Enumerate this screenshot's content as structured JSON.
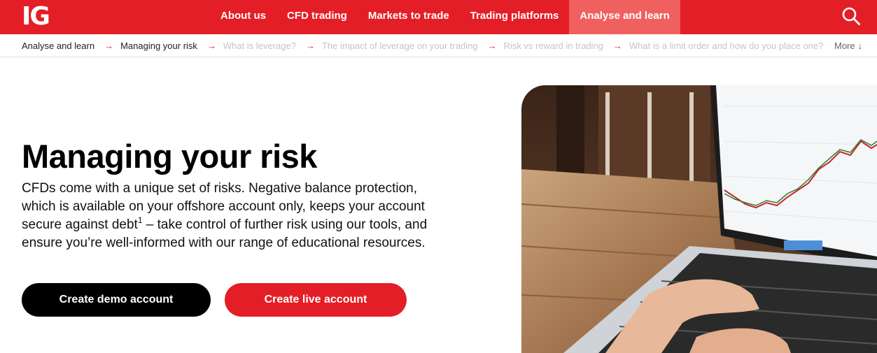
{
  "brand": {
    "logo_text": "IG",
    "accent": "#e41e26",
    "active_tab_bg": "#f0605f"
  },
  "nav": {
    "items": [
      {
        "label": "About us",
        "active": false
      },
      {
        "label": "CFD trading",
        "active": false
      },
      {
        "label": "Markets to trade",
        "active": false
      },
      {
        "label": "Trading platforms",
        "active": false
      },
      {
        "label": "Analyse and learn",
        "active": true
      }
    ],
    "search_icon": "search-icon"
  },
  "breadcrumb": {
    "items": [
      "Analyse and learn",
      "Managing your risk",
      "What is leverage?",
      "The impact of leverage on your trading",
      "Risk vs reward in trading",
      "What is a limit order and how do you place one?"
    ],
    "arrow_glyph": "→",
    "more_label": "More",
    "more_glyph": "↓"
  },
  "hero": {
    "title": "Managing your risk",
    "text_before": "CFDs come with a unique set of risks. Negative balance protection, which is available on your offshore account only, keeps your account secure against debt",
    "footnote": "1",
    "text_after": " – take control of further risk using our tools, and ensure you’re well-informed with our range of educational resources.",
    "demo_button": "Create demo account",
    "live_button": "Create live account"
  }
}
